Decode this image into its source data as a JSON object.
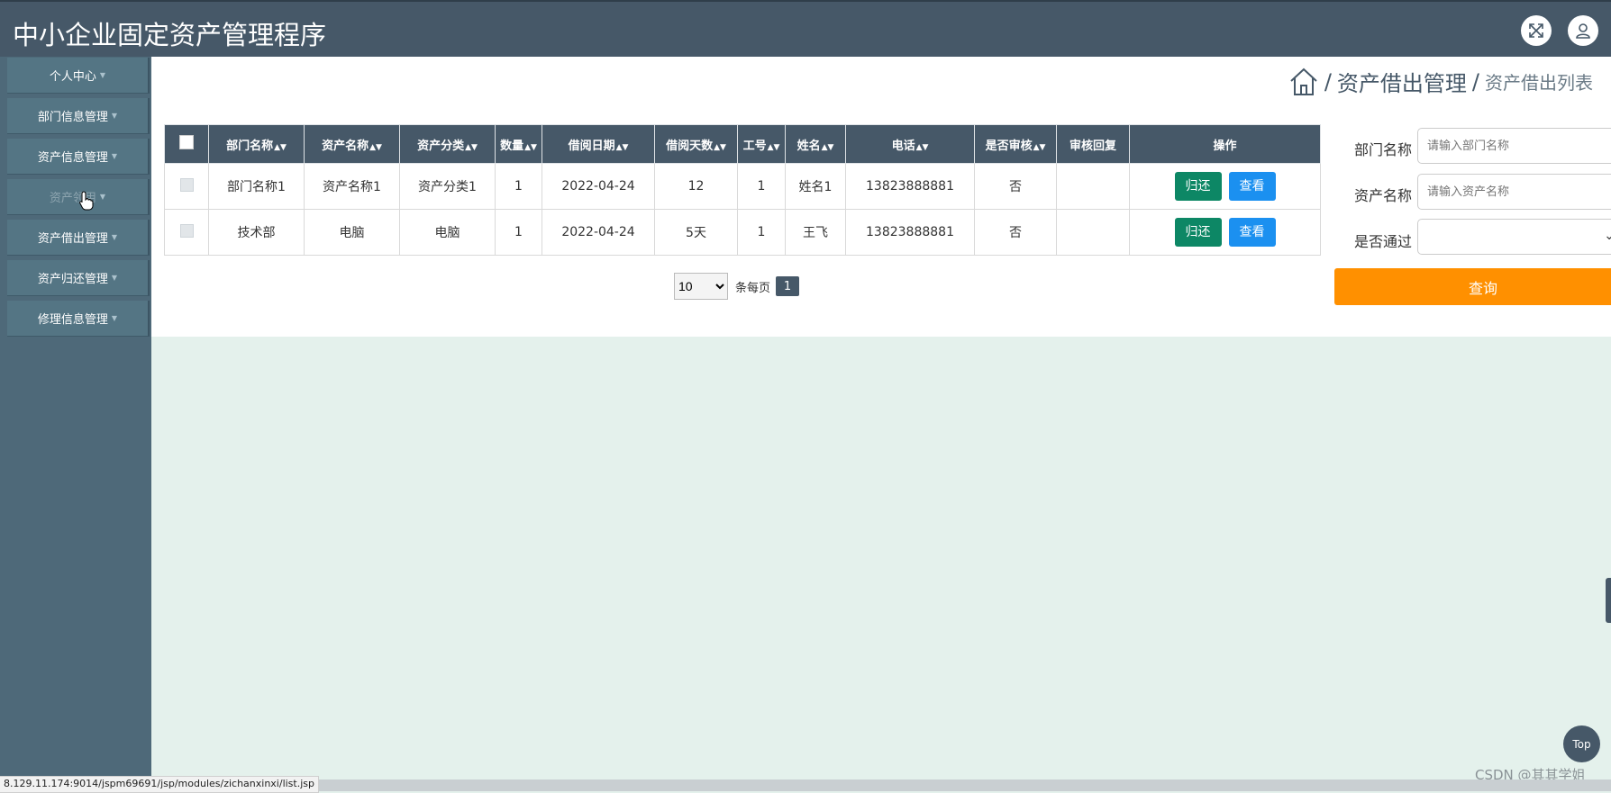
{
  "app": {
    "title": "中小企业固定资产管理程序"
  },
  "header": {
    "fullscreen_icon": "expand-icon",
    "user_icon": "user-icon"
  },
  "sidebar": {
    "items": [
      {
        "label": "个人中心"
      },
      {
        "label": "部门信息管理"
      },
      {
        "label": "资产信息管理"
      },
      {
        "label": "资产领用"
      },
      {
        "label": "资产借出管理"
      },
      {
        "label": "资产归还管理"
      },
      {
        "label": "修理信息管理"
      }
    ]
  },
  "breadcrumb": {
    "home_icon": "home-icon",
    "level1": "资产借出管理",
    "level2": "资产借出列表"
  },
  "table": {
    "headers": [
      "部门名称",
      "资产名称",
      "资产分类",
      "数量",
      "借阅日期",
      "借阅天数",
      "工号",
      "姓名",
      "电话",
      "是否审核",
      "审核回复",
      "操作"
    ],
    "rows": [
      {
        "dept": "部门名称1",
        "asset": "资产名称1",
        "category": "资产分类1",
        "qty": "1",
        "date": "2022-04-24",
        "days": "12",
        "emp_no": "1",
        "name": "姓名1",
        "phone": "13823888881",
        "audited": "否",
        "reply": ""
      },
      {
        "dept": "技术部",
        "asset": "电脑",
        "category": "电脑",
        "qty": "1",
        "date": "2022-04-24",
        "days": "5天",
        "emp_no": "1",
        "name": "王飞",
        "phone": "13823888881",
        "audited": "否",
        "reply": ""
      }
    ],
    "return_label": "归还",
    "view_label": "查看"
  },
  "pager": {
    "page_size": "10",
    "per_page_label": "条每页",
    "current_page": "1"
  },
  "search": {
    "dept_label": "部门名称",
    "dept_placeholder": "请输入部门名称",
    "asset_label": "资产名称",
    "asset_placeholder": "请输入资产名称",
    "pass_label": "是否通过",
    "query_label": "查询"
  },
  "back_to_top": "Top",
  "watermark": "CSDN @其其学姐",
  "status_url": "8.129.11.174:9014/jspm69691/jsp/modules/zichanxinxi/list.jsp",
  "colors": {
    "header": "#465868",
    "sidebar": "#4e6979",
    "return_btn": "#0d8765",
    "view_btn": "#1b90f0",
    "query_btn": "#ff9000"
  }
}
